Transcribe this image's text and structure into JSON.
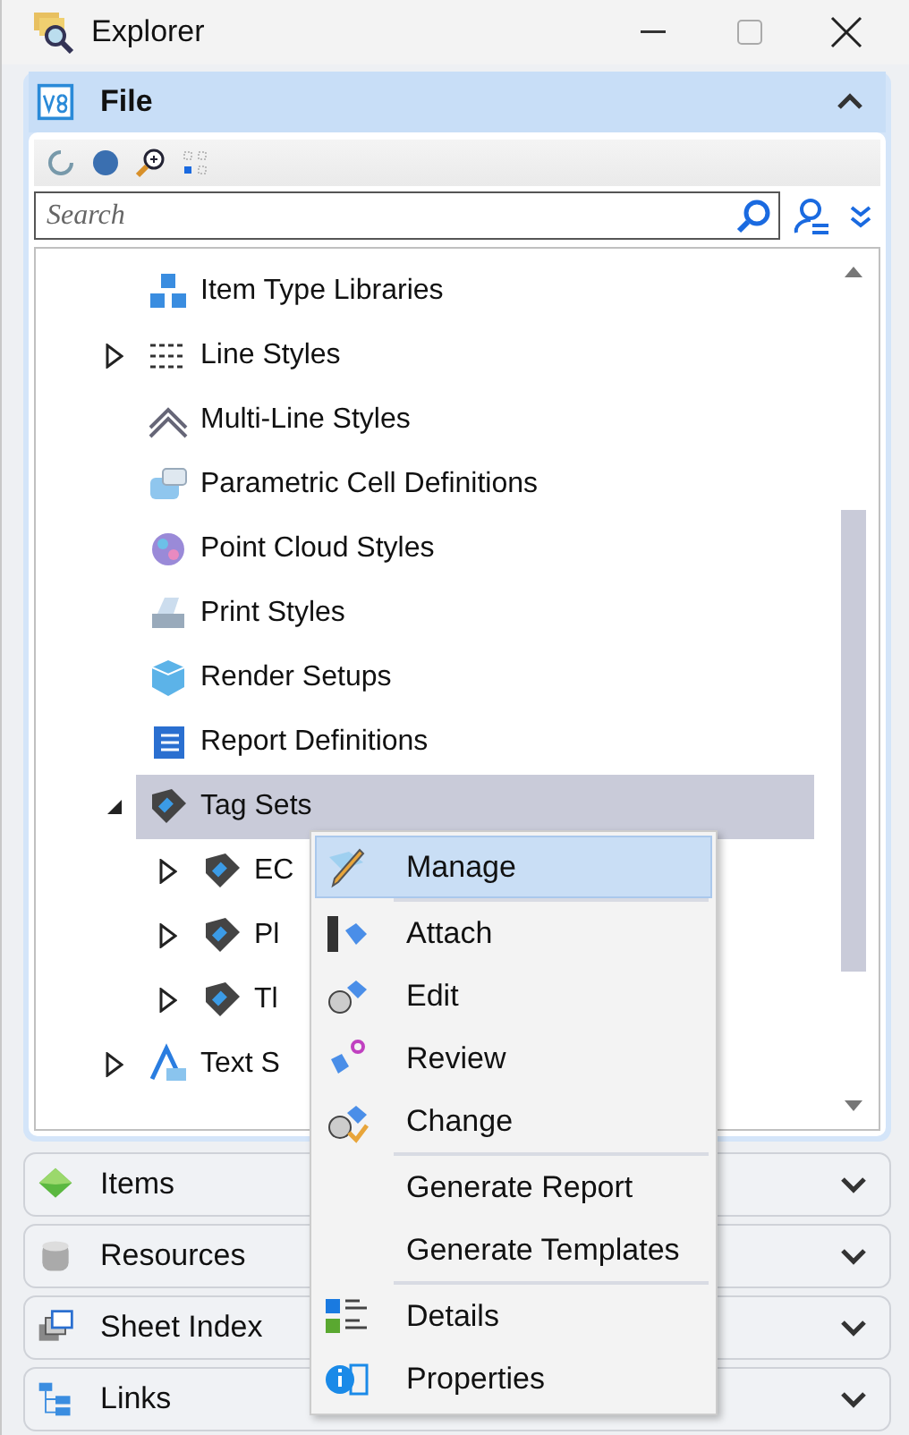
{
  "window": {
    "title": "Explorer"
  },
  "file_panel": {
    "title": "File",
    "expanded": true,
    "search": {
      "placeholder": "Search"
    },
    "tree": [
      {
        "label": "Item Type Libraries",
        "kind": "cubes"
      },
      {
        "label": "Line Styles",
        "kind": "lines",
        "expanded": false
      },
      {
        "label": "Multi-Line Styles",
        "kind": "chevrons"
      },
      {
        "label": "Parametric Cell Definitions",
        "kind": "cell"
      },
      {
        "label": "Point Cloud Styles",
        "kind": "cloud"
      },
      {
        "label": "Print Styles",
        "kind": "printer"
      },
      {
        "label": "Render Setups",
        "kind": "cube"
      },
      {
        "label": "Report Definitions",
        "kind": "report"
      },
      {
        "label": "Tag Sets",
        "kind": "tag",
        "expanded": true,
        "selected": true,
        "children": [
          {
            "label": "EC",
            "kind": "tag",
            "expanded": false
          },
          {
            "label": "Pl",
            "kind": "tag",
            "expanded": false
          },
          {
            "label": "Tl",
            "kind": "tag",
            "expanded": false
          }
        ]
      },
      {
        "label": "Text S",
        "kind": "text",
        "expanded": false
      }
    ]
  },
  "panels": [
    {
      "title": "Items",
      "kind": "items",
      "expanded": false
    },
    {
      "title": "Resources",
      "kind": "resources",
      "expanded": false
    },
    {
      "title": "Sheet Index",
      "kind": "sheets",
      "expanded": false
    },
    {
      "title": "Links",
      "kind": "links",
      "expanded": false
    }
  ],
  "context_menu": [
    {
      "label": "Manage",
      "kind": "pencil",
      "selected": true
    },
    {
      "kind": "separator"
    },
    {
      "label": "Attach",
      "kind": "attach",
      "selected": false
    },
    {
      "label": "Edit",
      "kind": "edit",
      "selected": false
    },
    {
      "label": "Review",
      "kind": "review",
      "selected": false
    },
    {
      "label": "Change",
      "kind": "change",
      "selected": false
    },
    {
      "kind": "separator"
    },
    {
      "label": "Generate Report",
      "kind": "plain",
      "selected": false
    },
    {
      "label": "Generate Templates",
      "kind": "plain",
      "selected": false
    },
    {
      "kind": "separator"
    },
    {
      "label": "Details",
      "kind": "details",
      "selected": false
    },
    {
      "label": "Properties",
      "kind": "info",
      "selected": false
    }
  ]
}
